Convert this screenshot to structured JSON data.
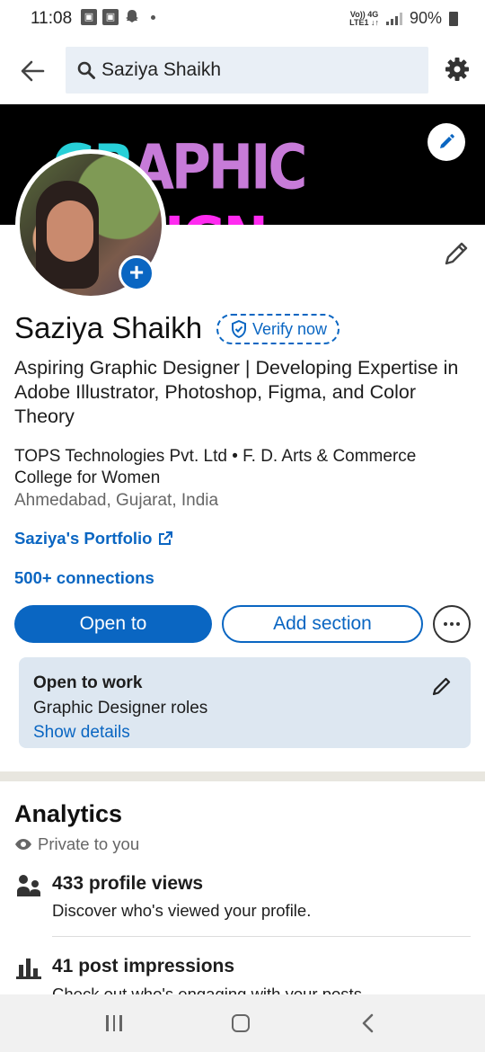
{
  "status_bar": {
    "time": "11:08",
    "network_top": "Vo)) 4G",
    "network_bottom": "LTE1 ↓↑",
    "battery": "90%"
  },
  "search": {
    "value": "Saziya Shaikh",
    "icon": "search-icon"
  },
  "banner": {
    "text_part1": "GR",
    "text_part2": "APHIC ",
    "text_part3": "DESIGN"
  },
  "profile": {
    "name": "Saziya Shaikh",
    "verify_label": "Verify now",
    "headline": "Aspiring Graphic Designer | Developing Expertise in Adobe Illustrator, Photoshop, Figma, and Color Theory",
    "organization": "TOPS Technologies Pvt. Ltd • F. D. Arts & Commerce College for Women",
    "location": "Ahmedabad, Gujarat, India",
    "portfolio_label": "Saziya's Portfolio",
    "connections": "500+ connections"
  },
  "actions": {
    "open_to": "Open to",
    "add_section": "Add section"
  },
  "open_to_work": {
    "title": "Open to work",
    "subtitle": "Graphic Designer roles",
    "link": "Show details"
  },
  "analytics": {
    "title": "Analytics",
    "privacy": "Private to you",
    "profile_views_title": "433 profile views",
    "profile_views_sub": "Discover who's viewed your profile.",
    "impressions_title": "41 post impressions",
    "impressions_sub": "Check out who's engaging with your posts."
  },
  "colors": {
    "brand": "#0a66c2",
    "card_bg": "#dde7f1",
    "search_bg": "#e9eff6"
  }
}
